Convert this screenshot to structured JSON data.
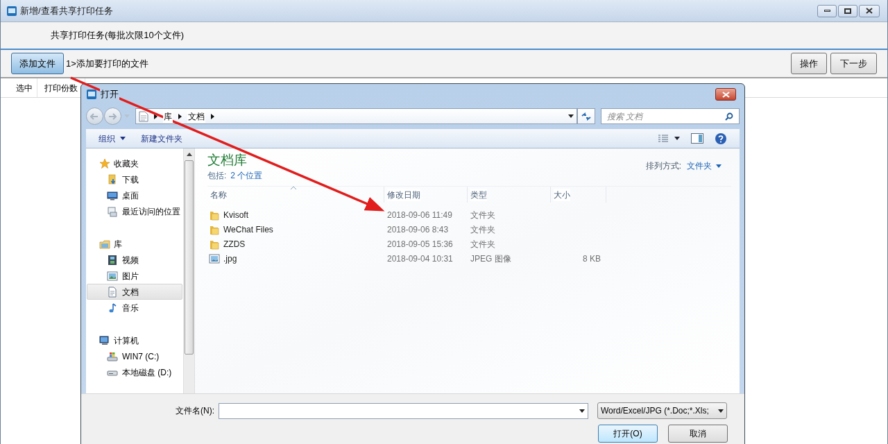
{
  "window": {
    "title": "新增/查看共享打印任务"
  },
  "header": {
    "text": "共享打印任务(每批次限10个文件)"
  },
  "toolbar": {
    "add_button": "添加文件",
    "hint": "1>添加要打印的文件",
    "buttons": [
      "操作",
      "下一步"
    ]
  },
  "table": {
    "columns": [
      "选中",
      "打印份数"
    ]
  },
  "dialog": {
    "title": "打开",
    "breadcrumb": [
      "库",
      "文档"
    ],
    "search": {
      "placeholder": "搜索 文档"
    },
    "commands": [
      {
        "label": "组织",
        "dropdown": true
      },
      {
        "label": "新建文件夹",
        "dropdown": false
      }
    ],
    "sidebar": [
      {
        "label": "收藏夹",
        "kind": "star",
        "children": [
          {
            "label": "下载",
            "kind": "download",
            "selected": false
          },
          {
            "label": "桌面",
            "kind": "desktop",
            "selected": false
          },
          {
            "label": "最近访问的位置",
            "kind": "recent",
            "selected": false
          }
        ]
      },
      {
        "label": "库",
        "kind": "library",
        "children": [
          {
            "label": "视频",
            "kind": "video",
            "selected": false
          },
          {
            "label": "图片",
            "kind": "picture",
            "selected": false
          },
          {
            "label": "文档",
            "kind": "document",
            "selected": true
          },
          {
            "label": "音乐",
            "kind": "music",
            "selected": false
          }
        ]
      },
      {
        "label": "计算机",
        "kind": "computer",
        "children": [
          {
            "label": "WIN7 (C:)",
            "kind": "system-drive",
            "selected": false
          },
          {
            "label": "本地磁盘 (D:)",
            "kind": "drive",
            "selected": false
          }
        ]
      }
    ],
    "library": {
      "title": "文档库",
      "includes_label": "包括:",
      "includes_link": "2 个位置",
      "sort_label": "排列方式:",
      "sort_value": "文件夹"
    },
    "columns": [
      "名称",
      "修改日期",
      "类型",
      "大小"
    ],
    "files": [
      {
        "name": "Kvisoft",
        "modified": "2018-09-06 11:49",
        "type": "文件夹",
        "kind": "folder"
      },
      {
        "name": "WeChat Files",
        "modified": "2018-09-06 8:43",
        "type": "文件夹",
        "kind": "folder"
      },
      {
        "name": "ZZDS",
        "modified": "2018-09-05 15:36",
        "type": "文件夹",
        "kind": "folder"
      },
      {
        "name": ".jpg",
        "modified": "2018-09-04 10:31",
        "type": "JPEG 图像",
        "size": "8 KB",
        "kind": "image"
      }
    ],
    "filename_label": "文件名(N):",
    "filetype": "Word/Excel/JPG (*.Doc;*.Xls;",
    "buttons": [
      "打开(O)",
      "取消"
    ]
  }
}
